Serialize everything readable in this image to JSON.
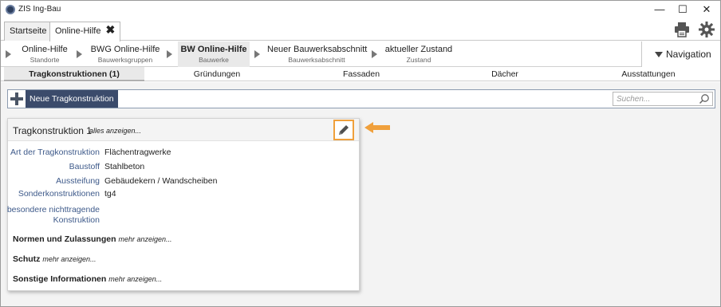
{
  "window": {
    "title": "ZIS Ing-Bau",
    "minimize_glyph": "—",
    "maximize_glyph": "☐",
    "close_glyph": "✕"
  },
  "tabs": [
    {
      "label": "Startseite",
      "active": false
    },
    {
      "label": "Online-Hilfe",
      "active": true,
      "close_glyph": "✖"
    }
  ],
  "toolbar_icons": [
    "printer-icon",
    "gear-icon"
  ],
  "breadcrumb": [
    {
      "main": "Online-Hilfe",
      "sub": "Standorte",
      "active": false
    },
    {
      "main": "BWG Online-Hilfe",
      "sub": "Bauwerksgruppen",
      "active": false
    },
    {
      "main": "BW Online-Hilfe",
      "sub": "Bauwerke",
      "active": true
    },
    {
      "main": "Neuer Bauwerksabschnitt",
      "sub": "Bauwerksabschnitt",
      "active": false
    },
    {
      "main": "aktueller Zustand",
      "sub": "Zustand",
      "active": false
    }
  ],
  "navigation_label": "Navigation",
  "subtabs": [
    {
      "label": "Tragkonstruktionen  (1)",
      "active": true
    },
    {
      "label": "Gründungen",
      "active": false
    },
    {
      "label": "Fassaden",
      "active": false
    },
    {
      "label": "Dächer",
      "active": false
    },
    {
      "label": "Ausstattungen",
      "active": false
    }
  ],
  "add_button_label": "Neue Tragkonstruktion",
  "search_placeholder": "Suchen...",
  "card": {
    "title": "Tragkonstruktion 1",
    "show_all": "alles anzeigen...",
    "properties": [
      {
        "key": "Art der Tragkonstruktion",
        "value": "Flächentragwerke"
      },
      {
        "key": "Baustoff",
        "value": "Stahlbeton"
      },
      {
        "key": "Aussteifung",
        "value": "Gebäudekern / Wandscheiben"
      },
      {
        "key": "Sonderkonstruktionen",
        "value": "tg4"
      },
      {
        "key": "besondere nichttragende Konstruktion",
        "value": ""
      }
    ],
    "sections": [
      {
        "title": "Normen und Zulassungen",
        "more": "mehr anzeigen..."
      },
      {
        "title": "Schutz",
        "more": "mehr anzeigen..."
      },
      {
        "title": "Sonstige Informationen",
        "more": "mehr anzeigen..."
      }
    ]
  },
  "colors": {
    "accent_dark": "#3b4b6b",
    "label_blue": "#3e5a8a",
    "highlight_orange": "#f0a03c"
  }
}
